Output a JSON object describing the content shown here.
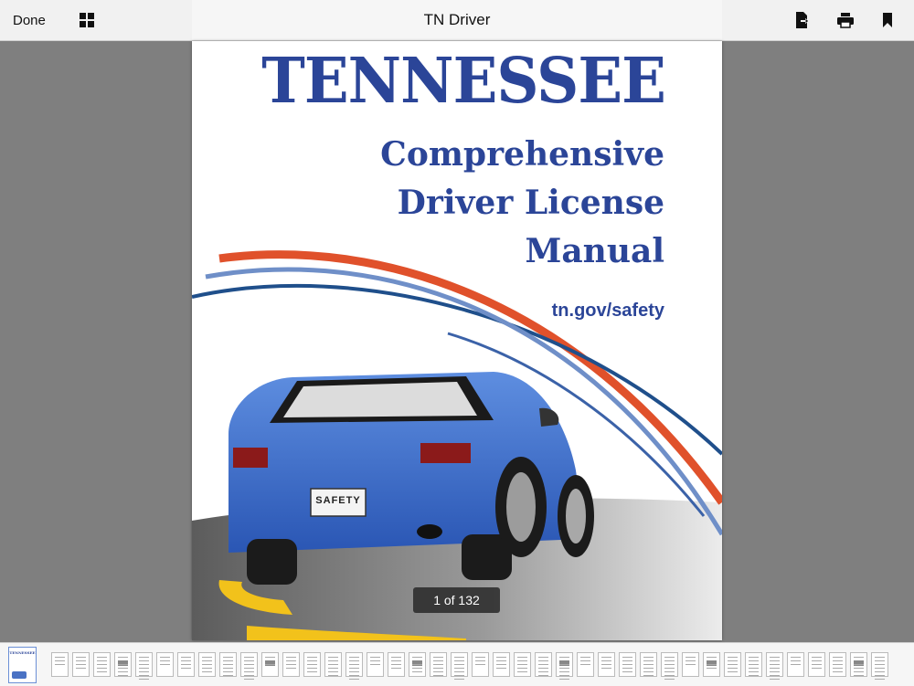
{
  "toolbar": {
    "done_label": "Done",
    "title": "TN Driver",
    "icons": [
      "grid-icon",
      "export-icon",
      "print-icon",
      "bookmark-icon"
    ]
  },
  "document": {
    "title": "TENNESSEE",
    "subtitle_lines": [
      "Comprehensive",
      "Driver License",
      "Manual"
    ],
    "url": "tn.gov/safety",
    "license_plate": "SAFETY",
    "brand_color": "#2b4598",
    "swoosh_colors": [
      "#e0512b",
      "#1f4f8b",
      "#6f8fc8"
    ]
  },
  "page_indicator": "1 of 132",
  "thumbnail_strip": {
    "first_thumb_title": "TENNESSEE",
    "selected_index": 0
  }
}
